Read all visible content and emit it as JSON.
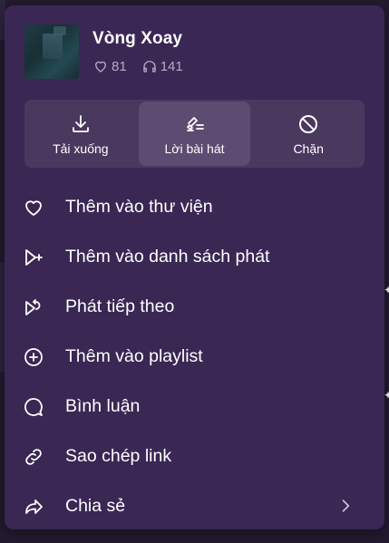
{
  "song": {
    "title": "Vòng Xoay",
    "likes": "81",
    "listens": "141"
  },
  "actions": [
    {
      "label": "Tải xuống",
      "icon": "download-icon"
    },
    {
      "label": "Lời bài hát",
      "icon": "lyrics-icon"
    },
    {
      "label": "Chặn",
      "icon": "block-icon"
    }
  ],
  "menu_items": [
    {
      "label": "Thêm vào thư viện",
      "icon": "heart-icon"
    },
    {
      "label": "Thêm vào danh sách phát",
      "icon": "add-to-queue-icon"
    },
    {
      "label": "Phát tiếp theo",
      "icon": "play-next-icon"
    },
    {
      "label": "Thêm vào playlist",
      "icon": "add-circle-icon"
    },
    {
      "label": "Bình luận",
      "icon": "comment-icon"
    },
    {
      "label": "Sao chép link",
      "icon": "link-icon"
    },
    {
      "label": "Chia sẻ",
      "icon": "share-icon"
    }
  ],
  "colors": {
    "menu_bg": "#3a2754",
    "action_bar_bg": "#4a385f",
    "action_active_bg": "#5d4b72",
    "page_bg": "#241b30"
  }
}
